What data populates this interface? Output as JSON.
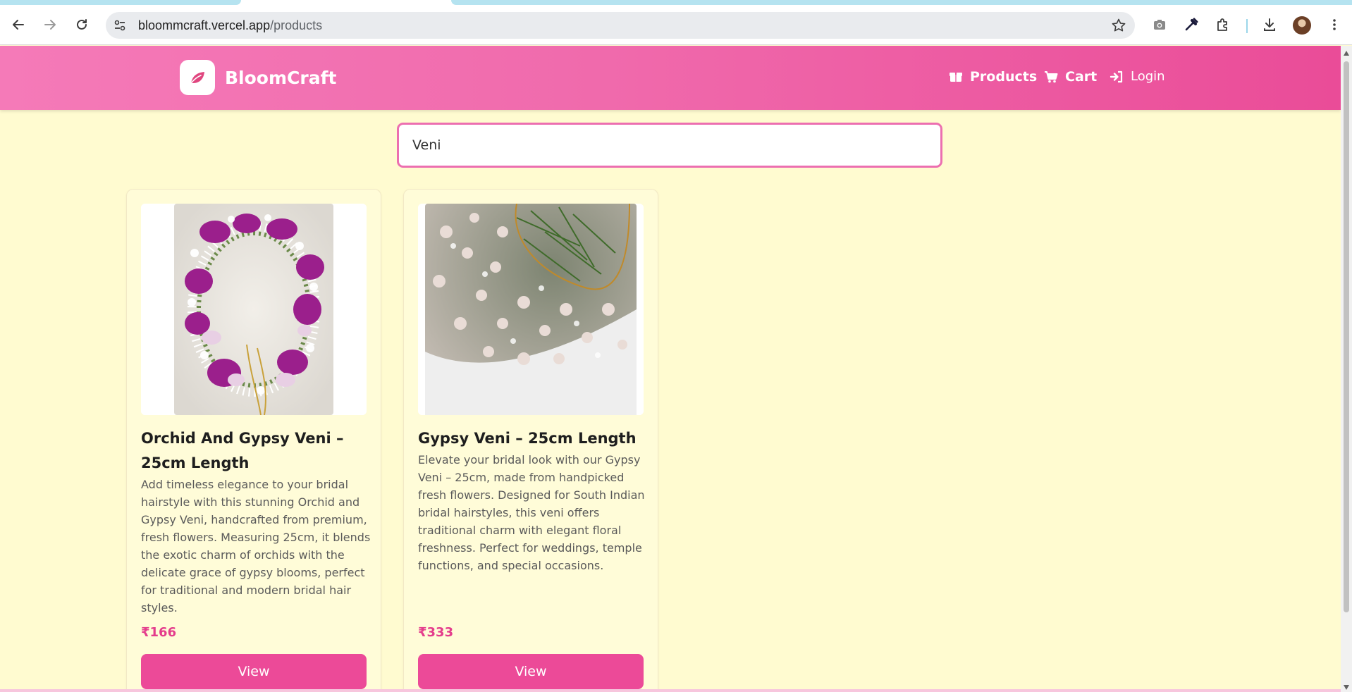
{
  "browser": {
    "url_host": "bloommcraft.vercel.app",
    "url_path": "/products",
    "icons": [
      "back-icon",
      "forward-icon",
      "reload-icon",
      "site-info-icon",
      "bookmark-star-icon",
      "screenshot-camera-icon",
      "eyedropper-icon",
      "extensions-icon",
      "download-icon",
      "profile-avatar",
      "menu-kebab-icon"
    ]
  },
  "header": {
    "brand": "BloomCraft",
    "nav": {
      "products": "Products",
      "cart": "Cart",
      "login": "Login"
    }
  },
  "search": {
    "value": "Veni"
  },
  "products": [
    {
      "title": "Orchid And Gypsy Veni – 25cm Length",
      "description": "Add timeless elegance to your bridal hairstyle with this stunning Orchid and Gypsy Veni, handcrafted from premium, fresh flowers. Measuring 25cm, it blends the exotic charm of orchids with the delicate grace of gypsy blooms, perfect for traditional and modern bridal hair styles.",
      "price": "₹166",
      "button": "View"
    },
    {
      "title": "Gypsy Veni – 25cm Length",
      "description": "Elevate your bridal look with our Gypsy Veni – 25cm, made from handpicked fresh flowers. Designed for South Indian bridal hairstyles, this veni offers traditional charm with elegant floral freshness. Perfect for weddings, temple functions, and special occasions.",
      "price": "₹333",
      "button": "View"
    }
  ],
  "colors": {
    "page_background": "#fffbd0",
    "header_gradient_start": "#f57ab8",
    "header_gradient_end": "#ea4c98",
    "accent": "#ec4a98",
    "price": "#e43c8c",
    "search_border": "#ec6fb0"
  }
}
